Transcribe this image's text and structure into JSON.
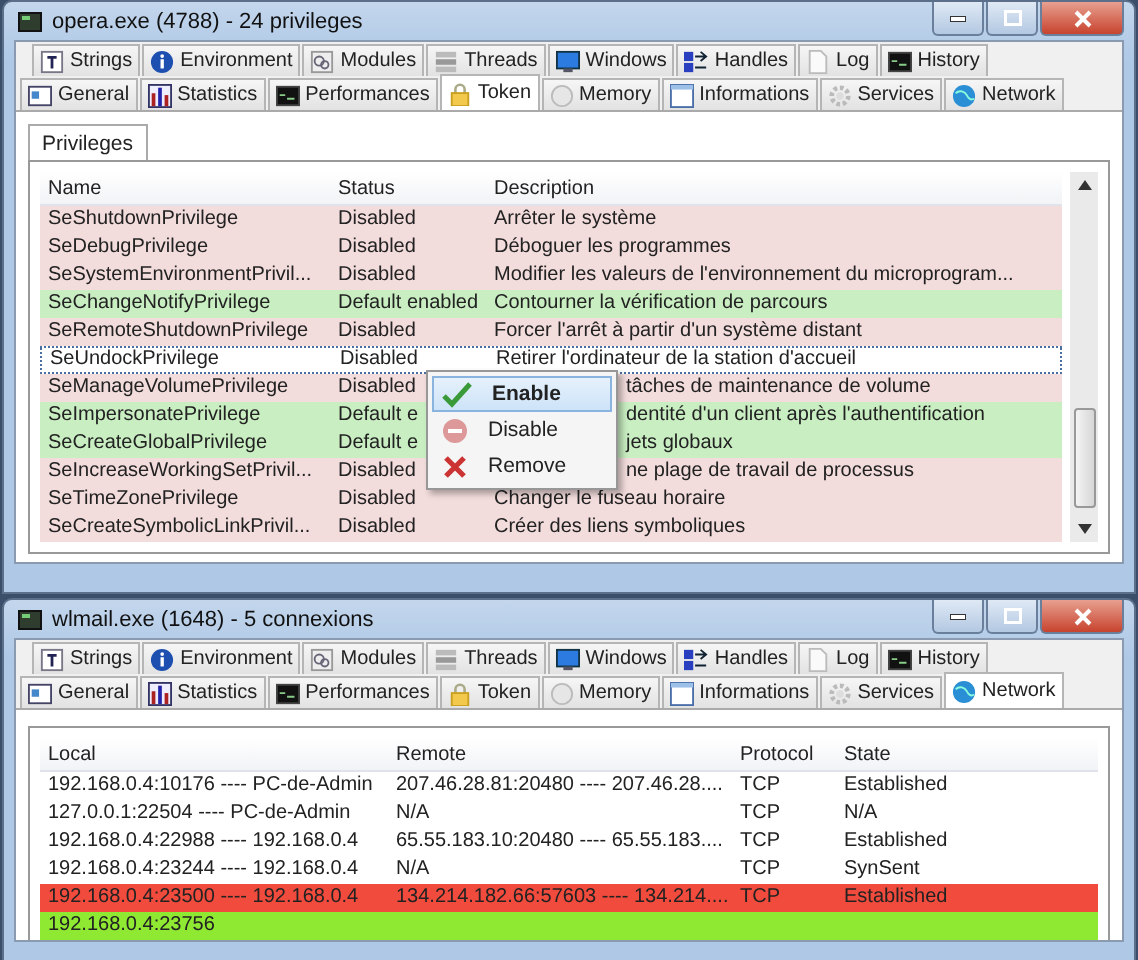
{
  "windows": [
    {
      "title": "opera.exe (4788) - 24 privileges",
      "tab_rows": [
        [
          {
            "label": "Strings",
            "kind": "text",
            "selected": false
          },
          {
            "label": "Environment",
            "kind": "info",
            "selected": false
          },
          {
            "label": "Modules",
            "kind": "modules",
            "selected": false
          },
          {
            "label": "Threads",
            "kind": "threads",
            "selected": false
          },
          {
            "label": "Windows",
            "kind": "monitor",
            "selected": false
          },
          {
            "label": "Handles",
            "kind": "handles",
            "selected": false
          },
          {
            "label": "Log",
            "kind": "page",
            "selected": false
          },
          {
            "label": "History",
            "kind": "terminal",
            "selected": false
          }
        ],
        [
          {
            "label": "General",
            "kind": "card",
            "selected": false
          },
          {
            "label": "Statistics",
            "kind": "bars",
            "selected": false
          },
          {
            "label": "Performances",
            "kind": "terminal",
            "selected": false
          },
          {
            "label": "Token",
            "kind": "lock",
            "selected": true
          },
          {
            "label": "Memory",
            "kind": "memory",
            "selected": false
          },
          {
            "label": "Informations",
            "kind": "window",
            "selected": false
          },
          {
            "label": "Services",
            "kind": "gear",
            "selected": false
          },
          {
            "label": "Network",
            "kind": "globe",
            "selected": false
          }
        ]
      ],
      "subtabs": [
        {
          "label": "Privileges",
          "selected": true
        }
      ],
      "table": {
        "columns": [
          "Name",
          "Status",
          "Description"
        ],
        "rows": [
          {
            "cells": [
              "SeShutdownPrivilege",
              "Disabled",
              "Arrêter le système"
            ],
            "color": "#f3dcdc",
            "selected": false
          },
          {
            "cells": [
              "SeDebugPrivilege",
              "Disabled",
              "Déboguer les programmes"
            ],
            "color": "#f3dcdc",
            "selected": false
          },
          {
            "cells": [
              "SeSystemEnvironmentPrivil...",
              "Disabled",
              "Modifier les valeurs de l'environnement du microprogram..."
            ],
            "color": "#f3dcdc",
            "selected": false
          },
          {
            "cells": [
              "SeChangeNotifyPrivilege",
              "Default enabled",
              "Contourner la vérification de parcours"
            ],
            "color": "#c9eec2",
            "selected": false
          },
          {
            "cells": [
              "SeRemoteShutdownPrivilege",
              "Disabled",
              "Forcer l'arrêt à partir d'un système distant"
            ],
            "color": "#f3dcdc",
            "selected": false
          },
          {
            "cells": [
              "SeUndockPrivilege",
              "Disabled",
              "Retirer l'ordinateur de la station d'accueil"
            ],
            "color": "#ffffff",
            "selected": true
          },
          {
            "cells": [
              "SeManageVolumePrivilege",
              "Disabled",
              "tâches de maintenance de volume"
            ],
            "color": "#f3dcdc",
            "selected": false
          },
          {
            "cells": [
              "SeImpersonatePrivilege",
              "Default e",
              "dentité d'un client après l'authentification"
            ],
            "color": "#c9eec2",
            "selected": false
          },
          {
            "cells": [
              "SeCreateGlobalPrivilege",
              "Default e",
              "jets globaux"
            ],
            "color": "#c9eec2",
            "selected": false
          },
          {
            "cells": [
              "SeIncreaseWorkingSetPrivil...",
              "Disabled",
              "ne plage de travail de processus"
            ],
            "color": "#f3dcdc",
            "selected": false
          },
          {
            "cells": [
              "SeTimeZonePrivilege",
              "Disabled",
              "Changer le fuseau horaire"
            ],
            "color": "#f3dcdc",
            "selected": false
          },
          {
            "cells": [
              "SeCreateSymbolicLinkPrivil...",
              "Disabled",
              "Créer des liens symboliques"
            ],
            "color": "#f3dcdc",
            "selected": false
          }
        ]
      },
      "context_menu": [
        {
          "label": "Enable",
          "kind": "check",
          "selected": true
        },
        {
          "label": "Disable",
          "kind": "minus",
          "selected": false
        },
        {
          "label": "Remove",
          "kind": "cross",
          "selected": false
        }
      ]
    },
    {
      "title": "wlmail.exe (1648) - 5 connexions",
      "tab_rows": [
        [
          {
            "label": "Strings",
            "kind": "text",
            "selected": false
          },
          {
            "label": "Environment",
            "kind": "info",
            "selected": false
          },
          {
            "label": "Modules",
            "kind": "modules",
            "selected": false
          },
          {
            "label": "Threads",
            "kind": "threads",
            "selected": false
          },
          {
            "label": "Windows",
            "kind": "monitor",
            "selected": false
          },
          {
            "label": "Handles",
            "kind": "handles",
            "selected": false
          },
          {
            "label": "Log",
            "kind": "page",
            "selected": false
          },
          {
            "label": "History",
            "kind": "terminal",
            "selected": false
          }
        ],
        [
          {
            "label": "General",
            "kind": "card",
            "selected": false
          },
          {
            "label": "Statistics",
            "kind": "bars",
            "selected": false
          },
          {
            "label": "Performances",
            "kind": "terminal",
            "selected": false
          },
          {
            "label": "Token",
            "kind": "lock",
            "selected": false
          },
          {
            "label": "Memory",
            "kind": "memory",
            "selected": false
          },
          {
            "label": "Informations",
            "kind": "window",
            "selected": false
          },
          {
            "label": "Services",
            "kind": "gear",
            "selected": false
          },
          {
            "label": "Network",
            "kind": "globe",
            "selected": true
          }
        ]
      ],
      "table": {
        "columns": [
          "Local",
          "Remote",
          "Protocol",
          "State"
        ],
        "rows": [
          {
            "cells": [
              "192.168.0.4:10176 ---- PC-de-Admin",
              "207.46.28.81:20480 ---- 207.46.28....",
              "TCP",
              "Established"
            ],
            "color": "#ffffff"
          },
          {
            "cells": [
              "127.0.0.1:22504 ---- PC-de-Admin",
              "N/A",
              "TCP",
              "N/A"
            ],
            "color": "#ffffff"
          },
          {
            "cells": [
              "192.168.0.4:22988 ---- 192.168.0.4",
              "65.55.183.10:20480 ---- 65.55.183....",
              "TCP",
              "Established"
            ],
            "color": "#ffffff"
          },
          {
            "cells": [
              "192.168.0.4:23244 ---- 192.168.0.4",
              "N/A",
              "TCP",
              "SynSent"
            ],
            "color": "#ffffff"
          },
          {
            "cells": [
              "192.168.0.4:23500 ---- 192.168.0.4",
              "134.214.182.66:57603 ---- 134.214....",
              "TCP",
              "Established"
            ],
            "color": "#f04b3c"
          },
          {
            "cells": [
              "192.168.0.4:23756"
            ],
            "color": "#8fe832"
          }
        ]
      }
    }
  ]
}
